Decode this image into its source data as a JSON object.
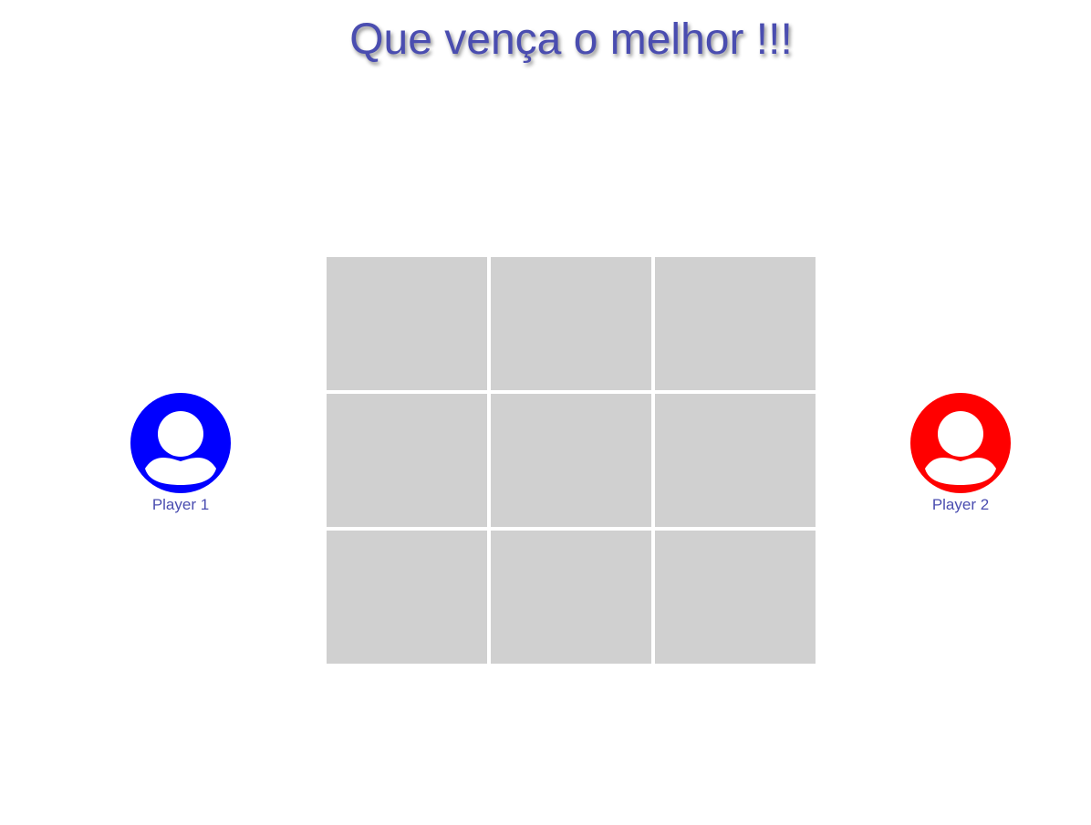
{
  "title": "Que vença o melhor !!!",
  "board": {
    "rows": 3,
    "cols": 3,
    "cells": [
      "",
      "",
      "",
      "",
      "",
      "",
      "",
      "",
      ""
    ]
  },
  "players": [
    {
      "label": "Player 1",
      "color": "#0000ff",
      "icon": "user-avatar-icon"
    },
    {
      "label": "Player 2",
      "color": "#ff0000",
      "icon": "user-avatar-icon"
    }
  ],
  "colors": {
    "title": "#4a4db0",
    "cell": "#d0d0d0",
    "background": "#ffffff"
  }
}
